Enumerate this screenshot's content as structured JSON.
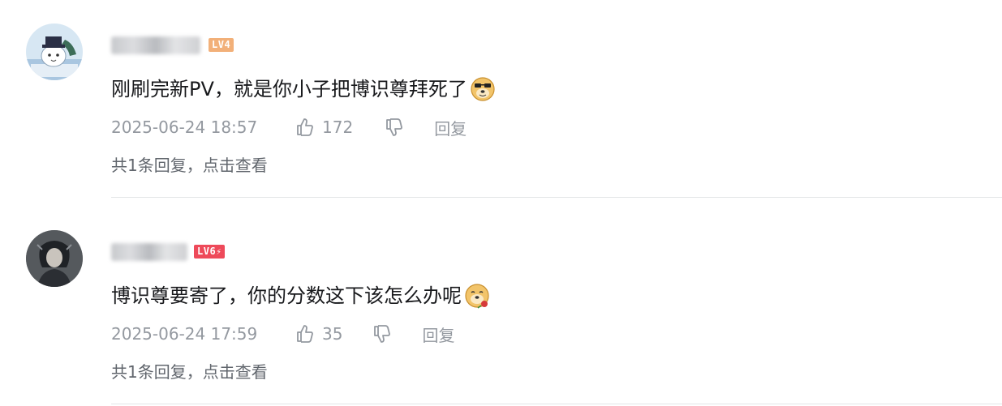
{
  "comments": [
    {
      "level": "LV4",
      "text": "刚刷完新PV，就是你小子把博识尊拜死了",
      "emoji": "doge-emoji",
      "time": "2025-06-24 18:57",
      "likes": "172",
      "reply_label": "回复",
      "view_replies": "共1条回复，点击查看",
      "level_color": "#f2b079"
    },
    {
      "level": "LV6",
      "text": "博识尊要寄了，你的分数这下该怎么办呢",
      "emoji": "doge-rose-emoji",
      "time": "2025-06-24 17:59",
      "likes": "35",
      "reply_label": "回复",
      "view_replies": "共1条回复，点击查看",
      "level_color": "#ee4a5a"
    }
  ],
  "icons": {
    "like": "thumbs-up-icon",
    "dislike": "thumbs-down-icon"
  }
}
